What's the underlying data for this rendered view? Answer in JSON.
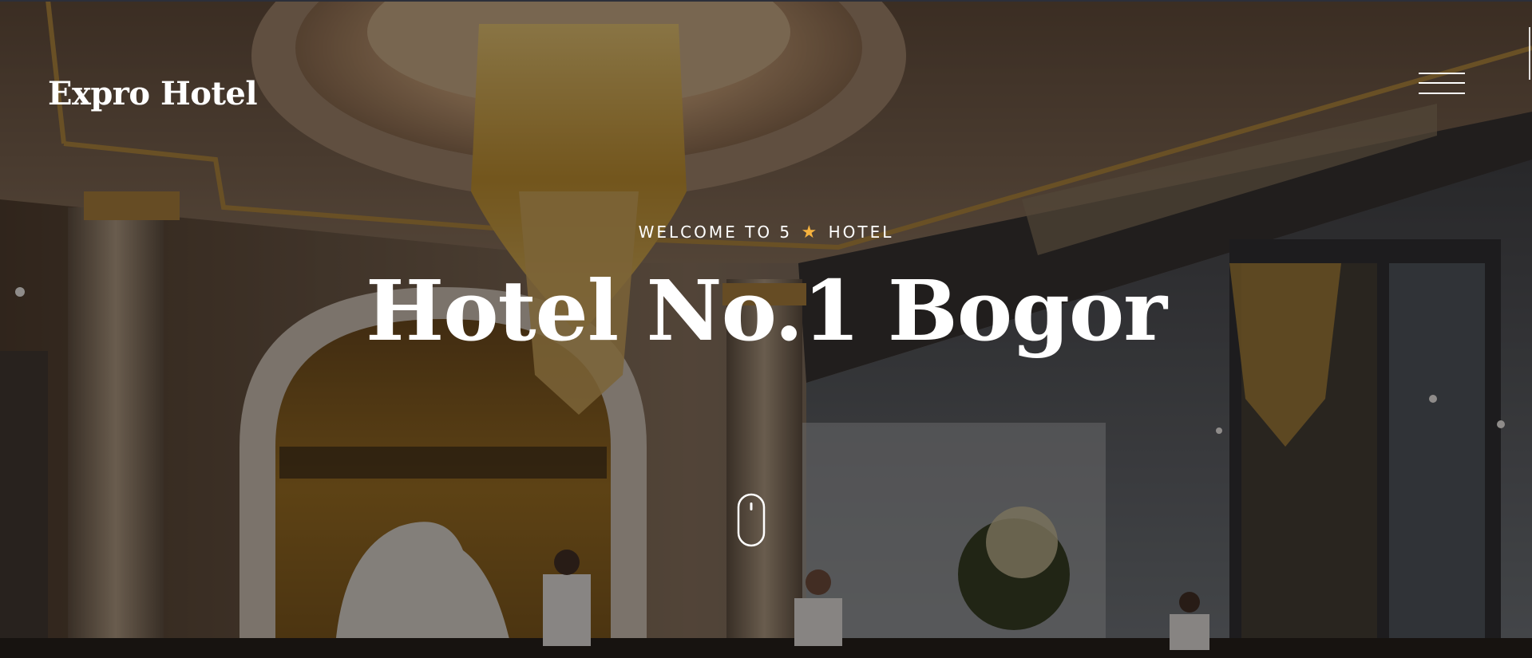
{
  "brand": {
    "name": "Expro Hotel"
  },
  "nav": {
    "menu_icon": "hamburger-menu-icon"
  },
  "hero": {
    "welcome_prefix": "WELCOME TO 5",
    "welcome_star": "★",
    "welcome_suffix": "HOTEL",
    "title": "Hotel No.1 Bogor",
    "scroll_icon": "mouse-scroll-icon"
  },
  "colors": {
    "text": "#ffffff",
    "star": "#f6b23e",
    "overlay": "#1a1410"
  }
}
